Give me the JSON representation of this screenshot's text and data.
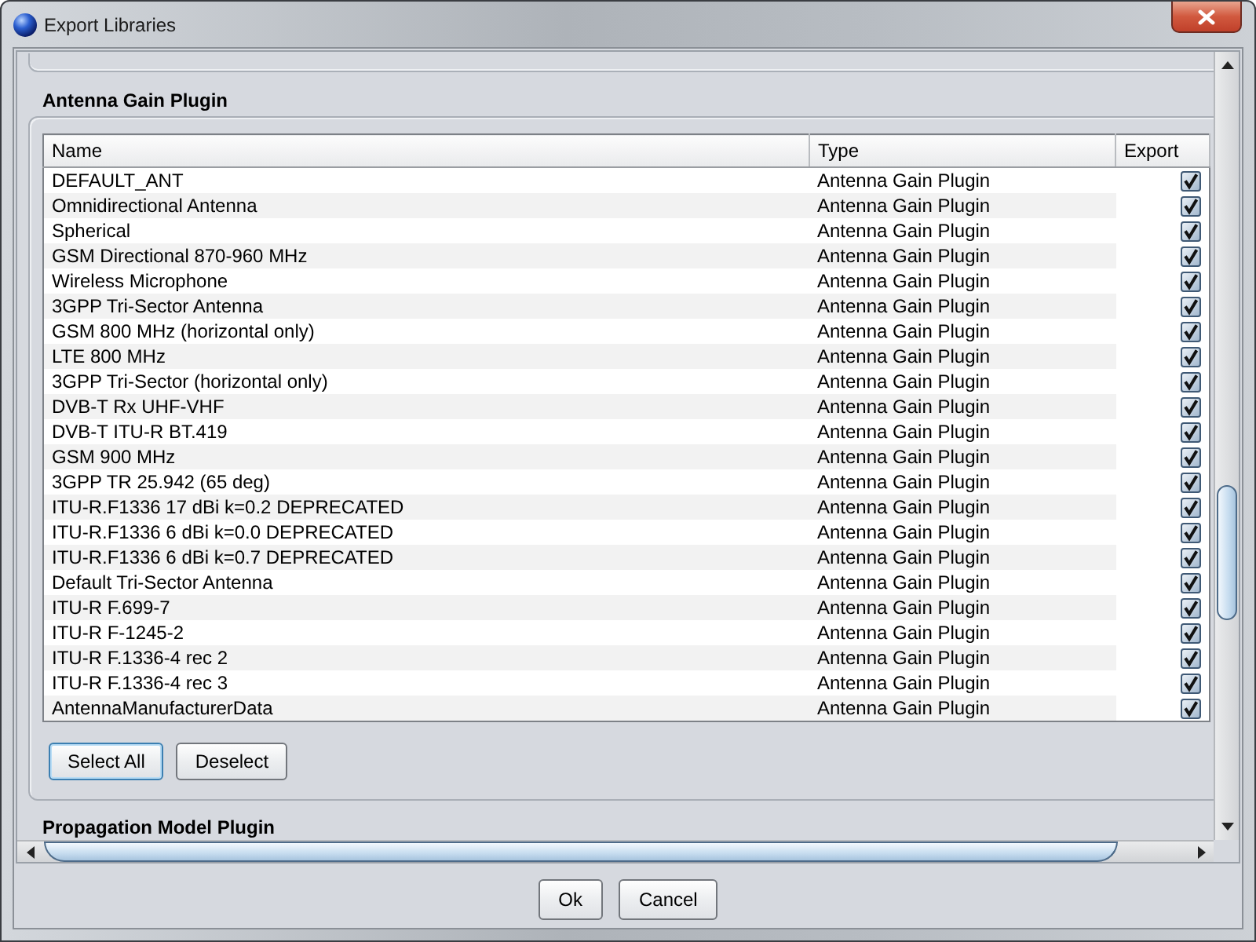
{
  "window": {
    "title": "Export Libraries"
  },
  "sections": [
    {
      "title": "Antenna Gain Plugin",
      "table": {
        "columns": [
          "Name",
          "Type",
          "Export"
        ],
        "rows": [
          {
            "name": "DEFAULT_ANT",
            "type": "Antenna Gain Plugin",
            "export": true
          },
          {
            "name": "Omnidirectional Antenna",
            "type": "Antenna Gain Plugin",
            "export": true
          },
          {
            "name": "Spherical",
            "type": "Antenna Gain Plugin",
            "export": true
          },
          {
            "name": "GSM Directional 870-960 MHz",
            "type": "Antenna Gain Plugin",
            "export": true
          },
          {
            "name": "Wireless Microphone",
            "type": "Antenna Gain Plugin",
            "export": true
          },
          {
            "name": "3GPP Tri-Sector Antenna",
            "type": "Antenna Gain Plugin",
            "export": true
          },
          {
            "name": "GSM 800 MHz (horizontal only)",
            "type": "Antenna Gain Plugin",
            "export": true
          },
          {
            "name": "LTE 800 MHz",
            "type": "Antenna Gain Plugin",
            "export": true
          },
          {
            "name": "3GPP Tri-Sector (horizontal only)",
            "type": "Antenna Gain Plugin",
            "export": true
          },
          {
            "name": "DVB-T Rx UHF-VHF",
            "type": "Antenna Gain Plugin",
            "export": true
          },
          {
            "name": "DVB-T ITU-R BT.419",
            "type": "Antenna Gain Plugin",
            "export": true
          },
          {
            "name": "GSM 900 MHz",
            "type": "Antenna Gain Plugin",
            "export": true
          },
          {
            "name": "3GPP TR 25.942 (65 deg)",
            "type": "Antenna Gain Plugin",
            "export": true
          },
          {
            "name": "ITU-R.F1336 17 dBi k=0.2 DEPRECATED",
            "type": "Antenna Gain Plugin",
            "export": true
          },
          {
            "name": "ITU-R.F1336 6 dBi k=0.0 DEPRECATED",
            "type": "Antenna Gain Plugin",
            "export": true
          },
          {
            "name": "ITU-R.F1336 6 dBi k=0.7 DEPRECATED",
            "type": "Antenna Gain Plugin",
            "export": true
          },
          {
            "name": "Default Tri-Sector Antenna",
            "type": "Antenna Gain Plugin",
            "export": true
          },
          {
            "name": "ITU-R F.699-7",
            "type": "Antenna Gain Plugin",
            "export": true
          },
          {
            "name": "ITU-R F-1245-2",
            "type": "Antenna Gain Plugin",
            "export": true
          },
          {
            "name": "ITU-R F.1336-4 rec 2",
            "type": "Antenna Gain Plugin",
            "export": true
          },
          {
            "name": "ITU-R F.1336-4 rec 3",
            "type": "Antenna Gain Plugin",
            "export": true
          },
          {
            "name": "AntennaManufacturerData",
            "type": "Antenna Gain Plugin",
            "export": true
          }
        ]
      },
      "buttons": [
        {
          "label": "Select All",
          "focused": true
        },
        {
          "label": "Deselect",
          "focused": false
        }
      ]
    },
    {
      "title": "Propagation Model Plugin"
    }
  ],
  "buttons": [
    "Ok",
    "Cancel"
  ]
}
